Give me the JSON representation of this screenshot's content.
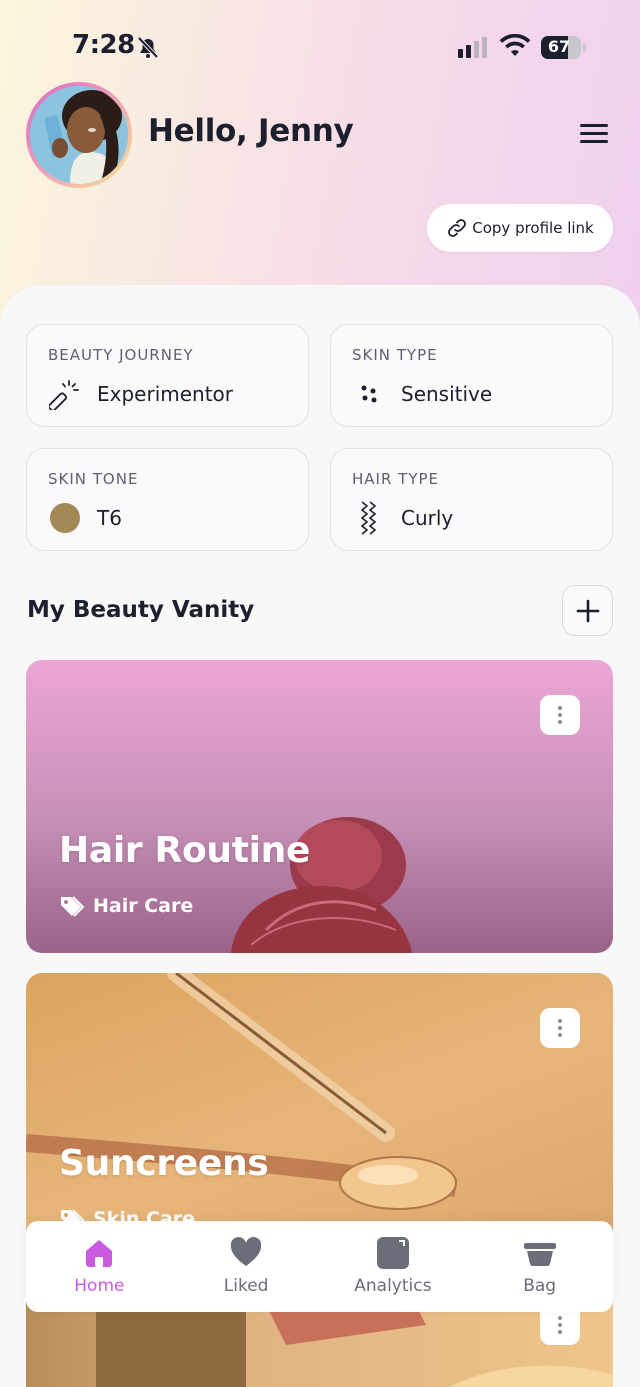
{
  "status_bar": {
    "time": "7:28",
    "battery": "67"
  },
  "header": {
    "greeting": "Hello, Jenny",
    "copy_link_label": "Copy profile link"
  },
  "traits": [
    {
      "label": "BEAUTY JOURNEY",
      "value": "Experimentor",
      "icon": "magic-wand-icon"
    },
    {
      "label": "SKIN TYPE",
      "value": "Sensitive",
      "icon": "dots-icon"
    },
    {
      "label": "SKIN TONE",
      "value": "T6",
      "icon": "tone-swatch-icon",
      "tone_color": "#a38858"
    },
    {
      "label": "HAIR TYPE",
      "value": "Curly",
      "icon": "wavy-lines-icon"
    }
  ],
  "vanity": {
    "title": "My Beauty Vanity",
    "cards": [
      {
        "title": "Hair Routine",
        "tag": "Hair Care"
      },
      {
        "title": "Suncreens",
        "tag": "Skin Care"
      }
    ]
  },
  "tabbar": [
    {
      "label": "Home",
      "icon": "home-icon",
      "active": true
    },
    {
      "label": "Liked",
      "icon": "heart-icon",
      "active": false
    },
    {
      "label": "Analytics",
      "icon": "analytics-icon",
      "active": false
    },
    {
      "label": "Bag",
      "icon": "bag-icon",
      "active": false
    }
  ],
  "colors": {
    "accent": "#c95be0",
    "text": "#1c1f2e",
    "muted": "#6b6d78"
  }
}
